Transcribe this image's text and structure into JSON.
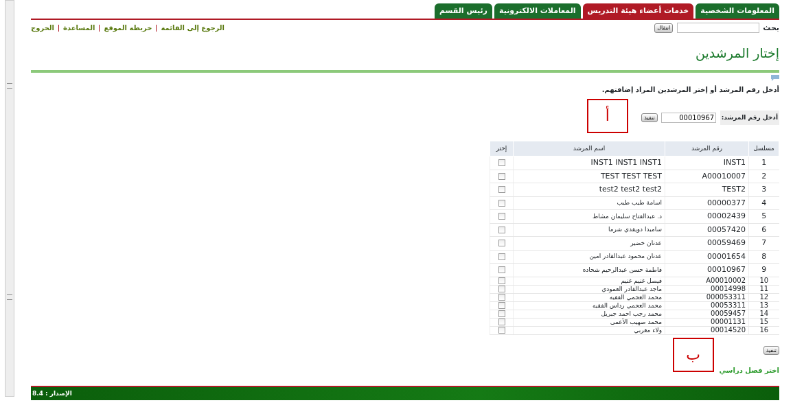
{
  "tabs": [
    {
      "label": "المعلومات الشخصية",
      "selected": false
    },
    {
      "label": "خدمات أعضاء هيئة التدريس",
      "selected": true
    },
    {
      "label": "المعاملات الالكترونية",
      "selected": false
    },
    {
      "label": "رئيس القسم",
      "selected": false
    }
  ],
  "search": {
    "label": "بحث",
    "button": "انتقال"
  },
  "links": [
    "الرجوع إلى القائمة",
    "خريطة الموقع",
    "المساعدة",
    "الخروج"
  ],
  "title": "إختار المرشدين",
  "instruction": "أدخل رقم المرشد أو إختر المرشدين المراد إضافتهم.",
  "advisor_input": {
    "label": "أدخل رقم المرشد:",
    "value": "00010967",
    "button": "تنفيذ"
  },
  "table": {
    "columns": [
      "مسلسل",
      "رقم المرشد",
      "اسم المرشد",
      "إختر"
    ],
    "rows": [
      {
        "serial": "1",
        "id": "INST1",
        "name": "INST1 INST1 INST1",
        "checked": false
      },
      {
        "serial": "2",
        "id": "A00010007",
        "name": "TEST TEST TEST",
        "checked": false
      },
      {
        "serial": "3",
        "id": "TEST2",
        "name": "test2 test2 test2",
        "checked": false
      },
      {
        "serial": "4",
        "id": "00000377",
        "name": "اسامة طيب طيب",
        "checked": false
      },
      {
        "serial": "5",
        "id": "00002439",
        "name": "د. عبدالفتاح سليمان مشاط",
        "checked": false
      },
      {
        "serial": "6",
        "id": "00057420",
        "name": "سامبدا دويقدي شرما",
        "checked": false
      },
      {
        "serial": "7",
        "id": "00059469",
        "name": "عدنان خضير",
        "checked": false
      },
      {
        "serial": "8",
        "id": "00001654",
        "name": "عدنان محمود عبدالقادر امين",
        "checked": false
      },
      {
        "serial": "9",
        "id": "00010967",
        "name": "فاطمة حسن عبدالرحيم شحاده",
        "checked": false
      },
      {
        "serial": "10",
        "id": "A00010002",
        "name": "فيصل غنيم غنيم",
        "checked": false
      },
      {
        "serial": "11",
        "id": "00014998",
        "name": "ماجد عبدالقادر العمودي",
        "checked": false
      },
      {
        "serial": "12",
        "id": "000053311",
        "name": "محمد العجمي الفقيه",
        "checked": false
      },
      {
        "serial": "13",
        "id": "00053311",
        "name": "محمد العجمي رداس الفقيه",
        "checked": false
      },
      {
        "serial": "14",
        "id": "00059457",
        "name": "محمد رجب احمد جبريل",
        "checked": false
      },
      {
        "serial": "15",
        "id": "00001131",
        "name": "محمد صهيب الأعمى",
        "checked": false
      },
      {
        "serial": "16",
        "id": "00014520",
        "name": "ولاء مغربي",
        "checked": false
      }
    ]
  },
  "submit_button": "تنفيذ",
  "semester_label": "اختر فصل دراسي",
  "annotations": [
    {
      "label": "أ"
    },
    {
      "label": "ب"
    }
  ],
  "footer": {
    "version": "الإصدار : 8.4"
  }
}
